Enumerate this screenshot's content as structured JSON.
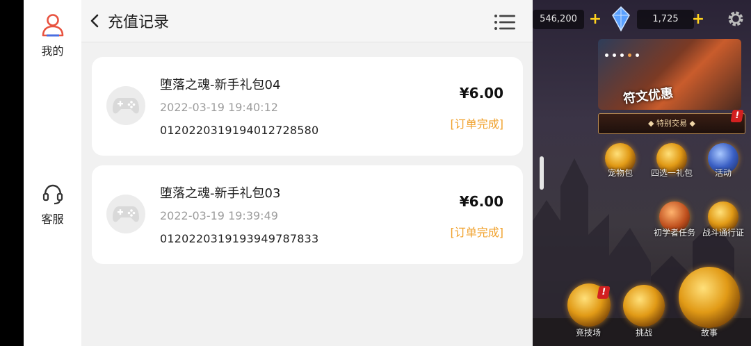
{
  "sidebar": {
    "items": [
      {
        "label": "我的",
        "icon": "user-icon"
      },
      {
        "label": "客服",
        "icon": "headset-icon"
      }
    ]
  },
  "header": {
    "title": "充值记录"
  },
  "records": [
    {
      "name": "堕落之魂-新手礼包04",
      "time": "2022-03-19 19:40:12",
      "order_id": "012022031919401272858​0",
      "price": "¥6.00",
      "status": "[订单完成]",
      "icon": "gamepad-icon"
    },
    {
      "name": "堕落之魂-新手礼包03",
      "time": "2022-03-19 19:39:49",
      "order_id": "0120220319193949787833",
      "price": "¥6.00",
      "status": "[订单完成]",
      "icon": "gamepad-icon"
    }
  ],
  "game": {
    "gold": "546,200",
    "gems": "1,725",
    "banner_text": "符文优惠",
    "special_label": "◆ 特别交易 ◆",
    "alert_mark": "!",
    "buttons": [
      {
        "label": "宠物包",
        "icon": "wolf-icon"
      },
      {
        "label": "四选一礼包",
        "icon": "chest-icon"
      },
      {
        "label": "活动",
        "icon": "hourglass-icon"
      },
      {
        "label": "初学者任务",
        "icon": "scroll-icon"
      },
      {
        "label": "战斗通行证",
        "icon": "helmet-icon"
      },
      {
        "label": "竞技场",
        "icon": "sword-icon"
      },
      {
        "label": "挑战",
        "icon": "skull-icon"
      },
      {
        "label": "故事",
        "icon": "crossed-swords-icon"
      }
    ]
  },
  "colors": {
    "status": "#f0a02a",
    "sidebar_icon": "#e8523f",
    "gold_plus": "#ffd21e"
  }
}
